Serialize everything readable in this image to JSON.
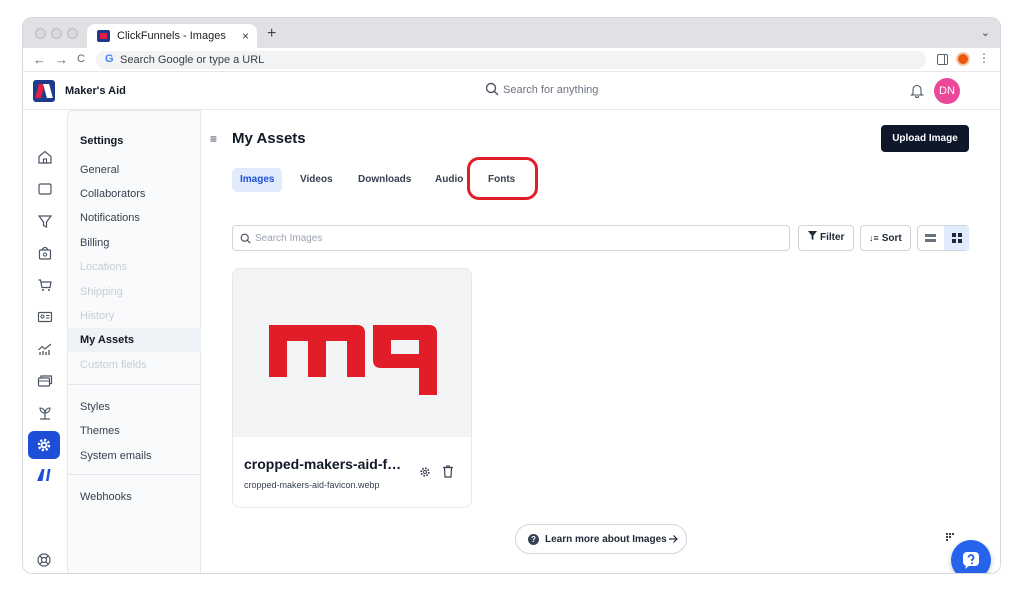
{
  "browser": {
    "tab_title": "ClickFunnels - Images",
    "tab_close": "×",
    "new_tab": "+",
    "tab_menu": "⌄",
    "back": "←",
    "forward": "→",
    "reload": "C",
    "omnibox_g": "G",
    "omnibox_placeholder": "Search Google or type a URL",
    "menu": "⋮"
  },
  "app": {
    "brand": "Maker's Aid",
    "search_placeholder": "Search for anything",
    "avatar_initials": "DN",
    "avatar_color": "#ec4899"
  },
  "rail": {
    "icons": [
      "home-icon",
      "page-icon",
      "funnel-icon",
      "shop-icon",
      "cart-icon",
      "contacts-icon",
      "analytics-icon",
      "payments-icon",
      "automation-icon",
      "settings-icon",
      "ai-icon"
    ],
    "active": "settings-icon",
    "ai_label": "AI"
  },
  "settings": {
    "title": "Settings",
    "items": [
      {
        "label": "General",
        "state": "normal"
      },
      {
        "label": "Collaborators",
        "state": "normal"
      },
      {
        "label": "Notifications",
        "state": "normal"
      },
      {
        "label": "Billing",
        "state": "normal"
      },
      {
        "label": "Locations",
        "state": "disabled"
      },
      {
        "label": "Shipping",
        "state": "disabled"
      },
      {
        "label": "History",
        "state": "disabled"
      },
      {
        "label": "My Assets",
        "state": "active"
      },
      {
        "label": "Custom fields",
        "state": "disabled"
      }
    ],
    "group2": [
      "Styles",
      "Themes",
      "System emails"
    ],
    "group3": [
      "Webhooks"
    ]
  },
  "main": {
    "menu_icon": "≡",
    "title": "My Assets",
    "upload_label": "Upload Image",
    "tabs": [
      {
        "label": "Images",
        "active": true
      },
      {
        "label": "Videos",
        "active": false
      },
      {
        "label": "Downloads",
        "active": false
      },
      {
        "label": "Audio",
        "active": false
      },
      {
        "label": "Fonts",
        "active": false
      }
    ],
    "highlighted_tab": "Fonts",
    "highlight_color": "#e11d27",
    "search_placeholder": "Search Images",
    "filter_label": "Filter",
    "sort_label": "Sort",
    "view_mode": "grid",
    "card": {
      "name": "cropped-makers-aid-fa...",
      "filename": "cropped-makers-aid-favicon.webp",
      "thumbnail_color": "#e11d27"
    },
    "learn_more": "Learn more about Images",
    "help_icon": "help-chat-icon"
  }
}
